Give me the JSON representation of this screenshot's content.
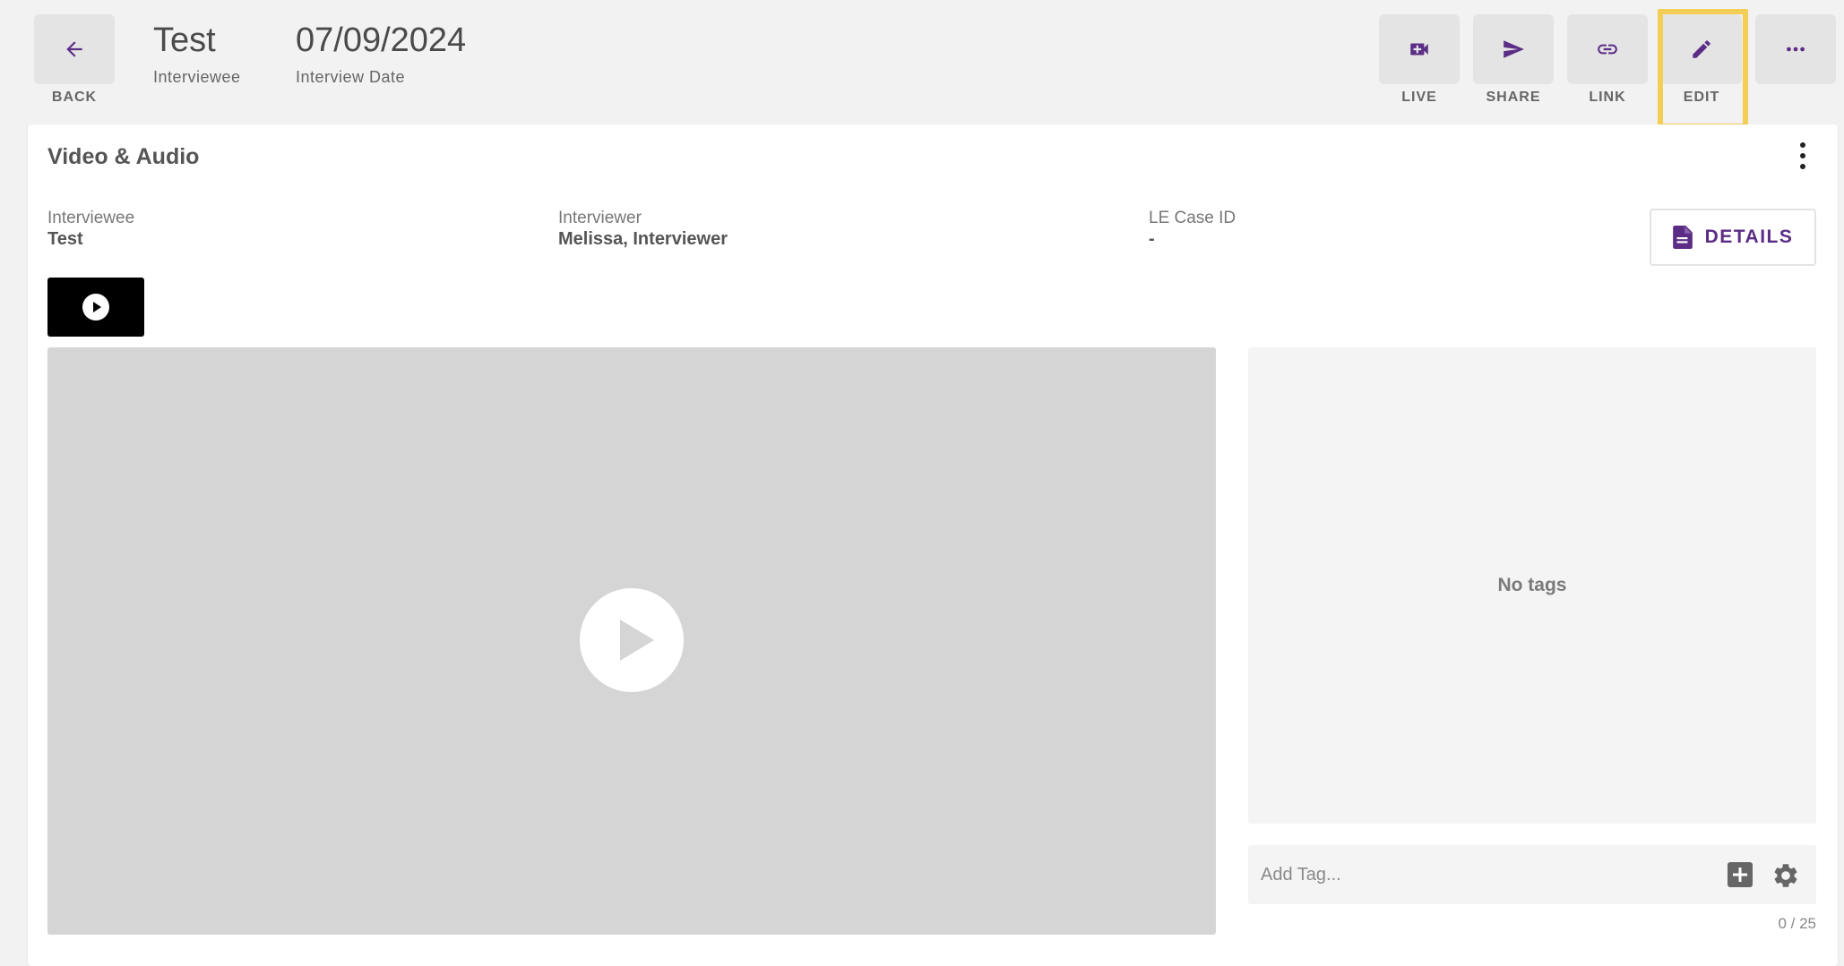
{
  "header": {
    "back_label": "BACK",
    "title": "Test",
    "title_sub": "Interviewee",
    "date": "07/09/2024",
    "date_sub": "Interview Date",
    "actions": [
      {
        "label": "LIVE",
        "icon": "video-plus-icon"
      },
      {
        "label": "SHARE",
        "icon": "send-icon"
      },
      {
        "label": "LINK",
        "icon": "link-icon"
      },
      {
        "label": "EDIT",
        "icon": "pencil-icon"
      },
      {
        "label": "",
        "icon": "more-horizontal-icon"
      }
    ]
  },
  "card": {
    "title": "Video & Audio",
    "interviewee_label": "Interviewee",
    "interviewee_value": "Test",
    "interviewer_label": "Interviewer",
    "interviewer_value": "Melissa, Interviewer",
    "case_label": "LE Case ID",
    "case_value": "-",
    "details_label": "DETAILS"
  },
  "tags": {
    "empty_text": "No tags",
    "input_placeholder": "Add Tag...",
    "count": "0 / 25"
  },
  "colors": {
    "accent": "#5b2d86",
    "highlight": "#f3cd55",
    "background": "#f2f2f2"
  }
}
